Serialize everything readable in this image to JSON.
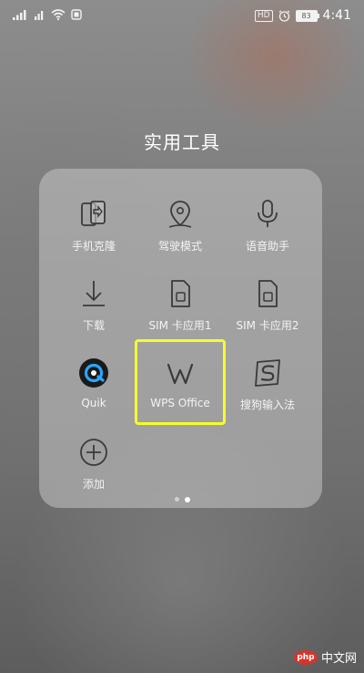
{
  "status_bar": {
    "battery": "83",
    "time": "4:41",
    "hd_label": "HD"
  },
  "folder": {
    "title": "实用工具",
    "apps": [
      {
        "label": "手机克隆",
        "icon": "phone-clone-icon"
      },
      {
        "label": "驾驶模式",
        "icon": "location-pin-icon"
      },
      {
        "label": "语音助手",
        "icon": "microphone-icon"
      },
      {
        "label": "下载",
        "icon": "download-icon"
      },
      {
        "label": "SIM 卡应用1",
        "icon": "sim-card-icon"
      },
      {
        "label": "SIM 卡应用2",
        "icon": "sim-card-icon"
      },
      {
        "label": "Quik",
        "icon": "quik-app-icon"
      },
      {
        "label": "WPS Office",
        "icon": "wps-office-icon"
      },
      {
        "label": "搜狗输入法",
        "icon": "sogou-input-icon"
      },
      {
        "label": "添加",
        "icon": "add-icon"
      }
    ],
    "pages": 2,
    "active_page": 2
  },
  "highlight_color": "#f6ff2a",
  "watermark": {
    "logo": "php",
    "text": "中文网"
  }
}
